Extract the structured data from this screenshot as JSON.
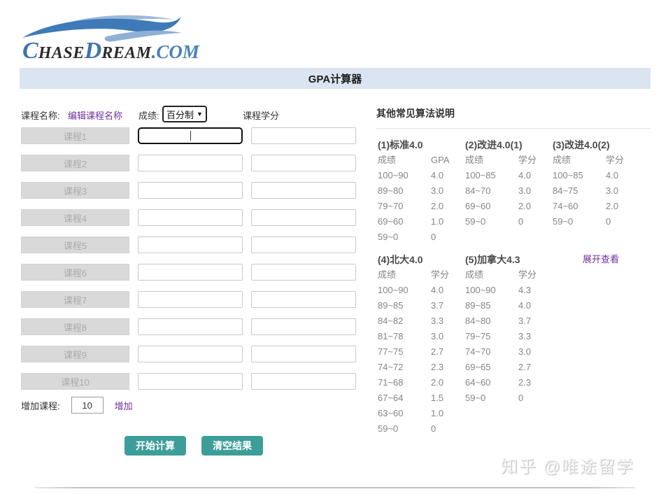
{
  "logo": {
    "part_c": "C",
    "part_hase": "HASE",
    "part_d": "D",
    "part_ream": "REAM",
    "part_com": ".COM"
  },
  "header": {
    "title": "GPA计算器"
  },
  "form": {
    "course_name_label": "课程名称:",
    "edit_link": "编辑课程名称",
    "score_label": "成绩:",
    "score_select_value": "百分制",
    "credit_label": "课程学分",
    "courses": [
      "课程1",
      "课程2",
      "课程3",
      "课程4",
      "课程5",
      "课程6",
      "课程7",
      "课程8",
      "课程9",
      "课程10"
    ],
    "add_label": "增加课程:",
    "add_count": "10",
    "add_link": "增加",
    "calc_button": "开始计算",
    "clear_button": "清空结果"
  },
  "algorithms": {
    "heading": "其他常见算法说明",
    "expand_link": "展开查看",
    "tables": [
      {
        "title": "(1)标准4.0",
        "col1": "成绩",
        "col2": "GPA",
        "rows": [
          [
            "100~90",
            "4.0"
          ],
          [
            "89~80",
            "3.0"
          ],
          [
            "79~70",
            "2.0"
          ],
          [
            "69~60",
            "1.0"
          ],
          [
            "59~0",
            "0"
          ]
        ]
      },
      {
        "title": "(2)改进4.0(1)",
        "col1": "成绩",
        "col2": "学分",
        "rows": [
          [
            "100~85",
            "4.0"
          ],
          [
            "84~70",
            "3.0"
          ],
          [
            "69~60",
            "2.0"
          ],
          [
            "59~0",
            "0"
          ]
        ]
      },
      {
        "title": "(3)改进4.0(2)",
        "col1": "成绩",
        "col2": "学分",
        "rows": [
          [
            "100~85",
            "4.0"
          ],
          [
            "84~75",
            "3.0"
          ],
          [
            "74~60",
            "2.0"
          ],
          [
            "59~0",
            "0"
          ]
        ]
      },
      {
        "title": "(4)北大4.0",
        "col1": "成绩",
        "col2": "学分",
        "rows": [
          [
            "100~90",
            "4.0"
          ],
          [
            "89~85",
            "3.7"
          ],
          [
            "84~82",
            "3.3"
          ],
          [
            "81~78",
            "3.0"
          ],
          [
            "77~75",
            "2.7"
          ],
          [
            "74~72",
            "2.3"
          ],
          [
            "71~68",
            "2.0"
          ],
          [
            "67~64",
            "1.5"
          ],
          [
            "63~60",
            "1.0"
          ],
          [
            "59~0",
            "0"
          ]
        ]
      },
      {
        "title": "(5)加拿大4.3",
        "col1": "成绩",
        "col2": "学分",
        "rows": [
          [
            "100~90",
            "4.3"
          ],
          [
            "89~85",
            "4.0"
          ],
          [
            "84~80",
            "3.7"
          ],
          [
            "79~75",
            "3.3"
          ],
          [
            "74~70",
            "3.0"
          ],
          [
            "69~65",
            "2.7"
          ],
          [
            "64~60",
            "2.3"
          ],
          [
            "59~0",
            "0"
          ]
        ]
      }
    ]
  },
  "watermark": "知乎 @唯途留学",
  "colors": {
    "header_bg": "#dbe5f1",
    "button_teal": "#3d9e99",
    "link_purple": "#7130a0",
    "logo_blue": "#3f74ad",
    "course_btn_bg": "#d9d9d9"
  }
}
